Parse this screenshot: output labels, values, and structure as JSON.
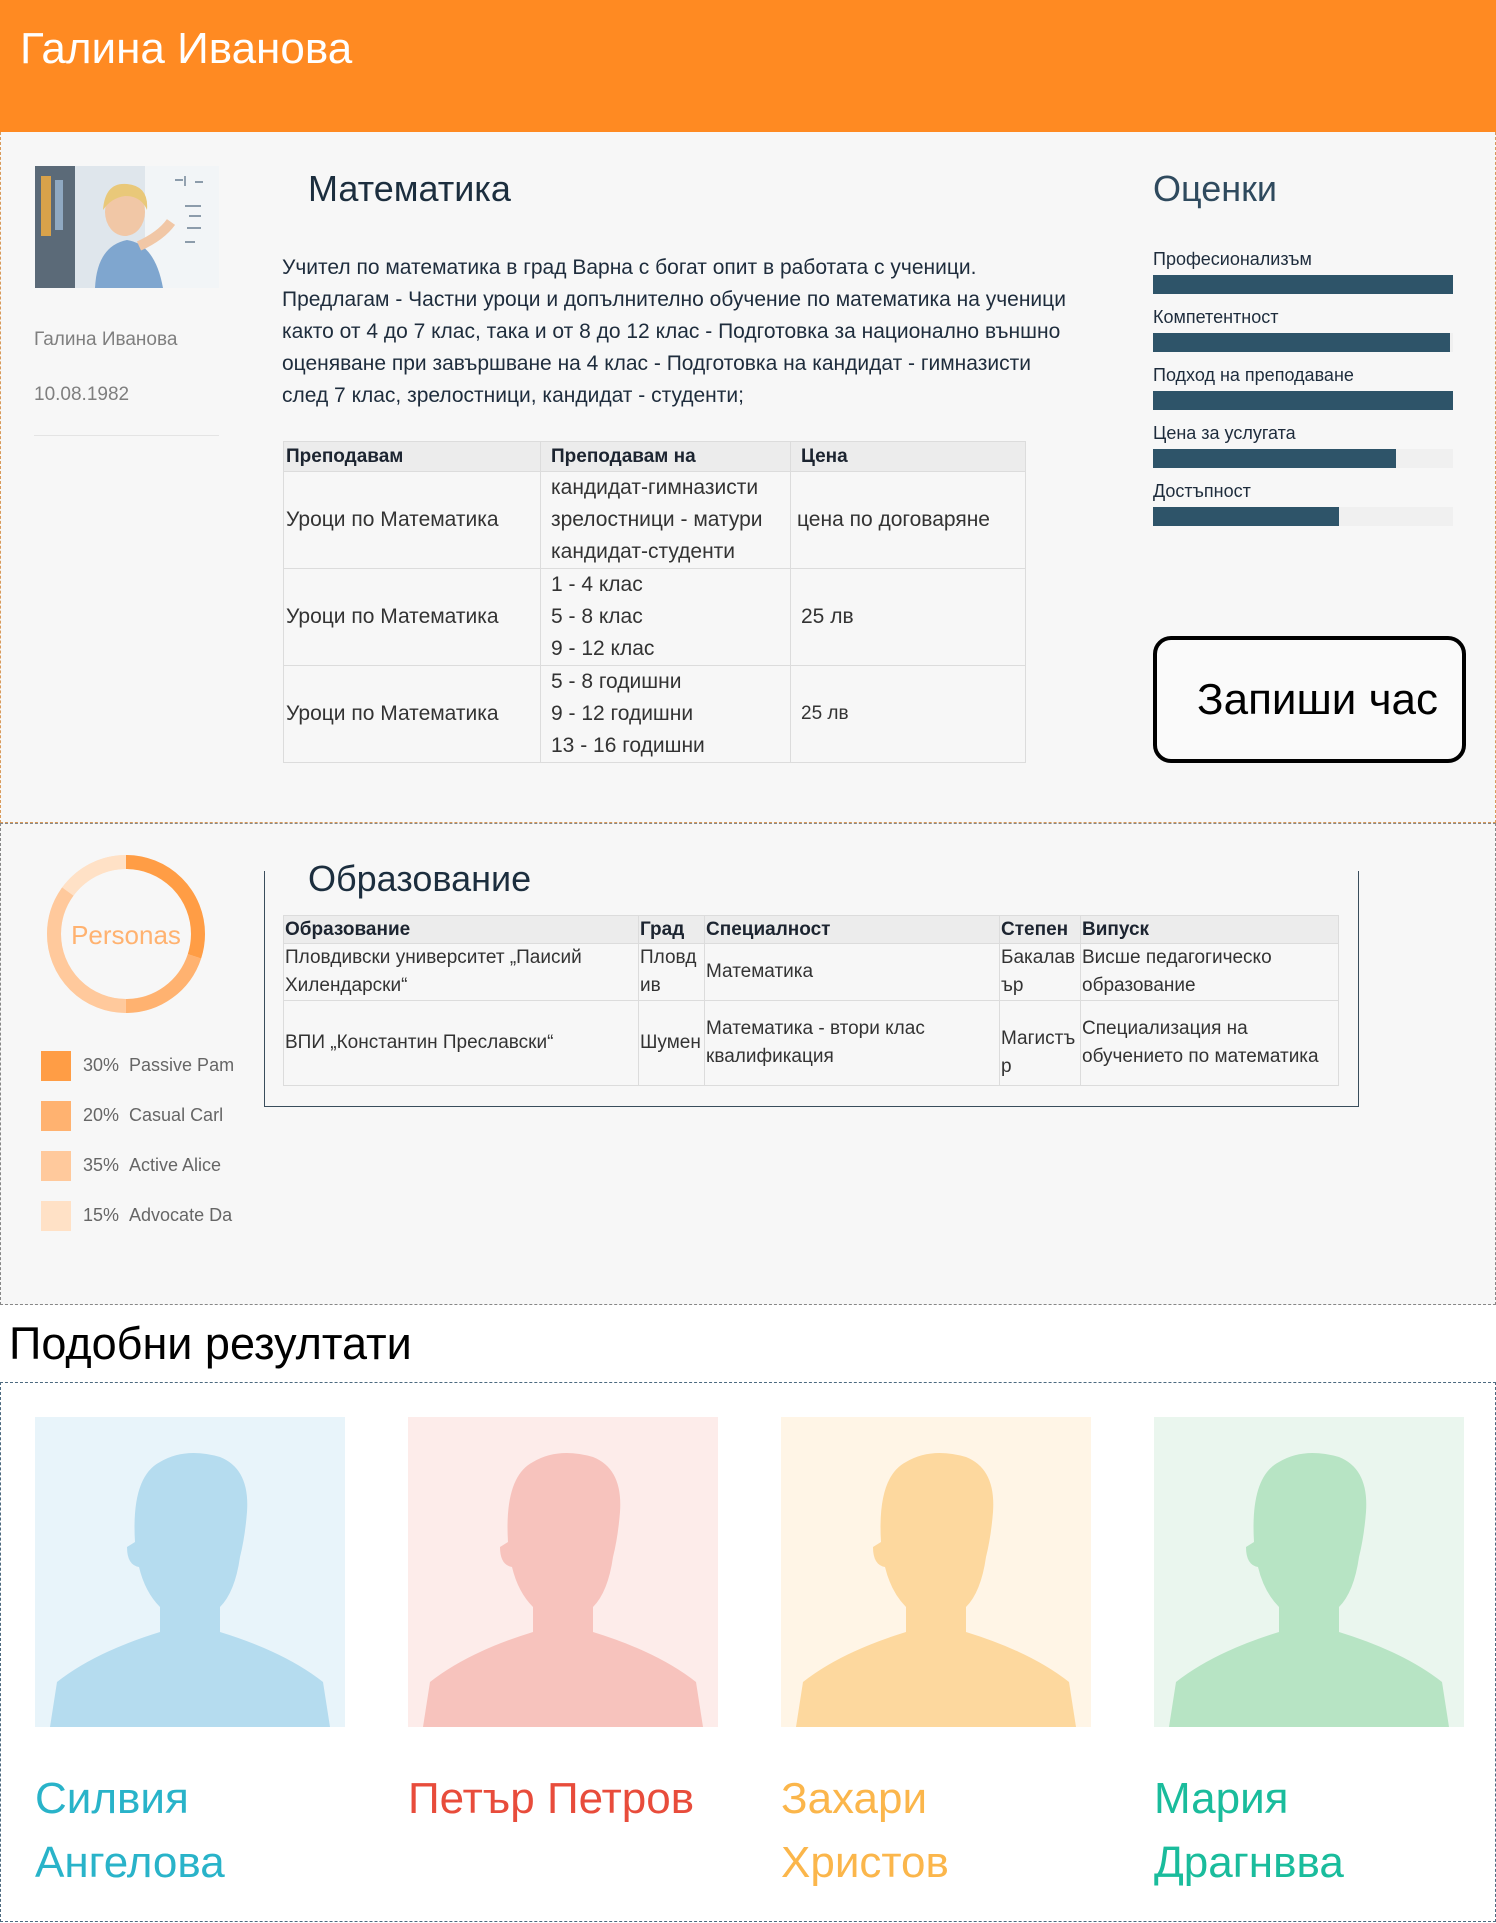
{
  "header": {
    "name": "Галина Иванова"
  },
  "profile": {
    "name": "Галина Иванова",
    "birthdate": "10.08.1982"
  },
  "subject": {
    "title": "Математика",
    "description": "Учител по математика в град Варна с богат опит в работата с ученици. Предлагам - Частни уроци и допълнително обучение по математика на  ученици както от 4 до 7 клас, така и от 8 до 12 клас - Подготовка за национално външно оценяване при завършване на 4 клас - Подготовка на кандидат - гимназисти след 7 клас, зрелостници, кандидат - студенти;"
  },
  "lessons": {
    "headers": [
      "Преподавам",
      "Преподавам на",
      "Цена"
    ],
    "rows": [
      {
        "subject": "Уроци по Математика",
        "audience": [
          "кандидат-гимназисти",
          "зрелостници - матури",
          "кандидат-студенти"
        ],
        "price": "цена по договаряне"
      },
      {
        "subject": "Уроци по Математика",
        "audience": [
          "1 - 4 клас",
          "5 - 8 клас",
          "9 - 12 клас"
        ],
        "price": "25 лв"
      },
      {
        "subject": "Уроци по Математика",
        "audience": [
          "5 - 8 годишни",
          "9 - 12 годишни",
          "13 - 16 годишни"
        ],
        "price": "25 лв"
      }
    ]
  },
  "ratings": {
    "title": "Оценки",
    "items": [
      {
        "label": "Професионализъм",
        "value": 1.0
      },
      {
        "label": "Компетентност",
        "value": 0.99
      },
      {
        "label": "Подход на преподаване",
        "value": 1.0
      },
      {
        "label": "Цена за услугата",
        "value": 0.81
      },
      {
        "label": "Достъпност",
        "value": 0.62
      }
    ],
    "accent_color": "#2e5469"
  },
  "book_button": {
    "label": "Запиши час"
  },
  "personas": {
    "center_label": "Personas",
    "items": [
      {
        "percent": "30%",
        "label": "Passive Pam",
        "color": "#ff9d45"
      },
      {
        "percent": "20%",
        "label": "Casual Carl",
        "color": "#ffb270"
      },
      {
        "percent": "35%",
        "label": "Active Alice",
        "color": "#ffc99c"
      },
      {
        "percent": "15%",
        "label": "Advocate Dan",
        "color": "#ffe1c6"
      }
    ]
  },
  "education": {
    "title": "Образование",
    "headers": [
      "Образование",
      "Град",
      "Специалност",
      "Степен",
      "Випуск"
    ],
    "rows": [
      {
        "school": "Пловдивски университет „Паисий Хилендарски“",
        "city": "Пловдив",
        "specialty": "Математика",
        "degree": "Бакалавър",
        "graduation": "Висше педагогическо образование"
      },
      {
        "school": "ВПИ „Константин Преславски“",
        "city": "Шумен",
        "specialty": "Математика - втори клас квалификация",
        "degree": "Магистър",
        "graduation": "Специализация на обучението по математика"
      }
    ]
  },
  "similar": {
    "title": "Подобни резултати",
    "people": [
      {
        "name": "Силвия Ангелова",
        "color": "#29b3c9",
        "bg": "#e8f4fa",
        "silhouette": "#b5dcef"
      },
      {
        "name": "Петър Петров",
        "color": "#e84c3b",
        "bg": "#fdecea",
        "silhouette": "#f7c3bd"
      },
      {
        "name": "Захари Христов",
        "color": "#fbb64b",
        "bg": "#fff5e6",
        "silhouette": "#fdd89e"
      },
      {
        "name": "Мария Драгнвва",
        "color": "#1abc9c",
        "bg": "#eaf6ee",
        "silhouette": "#b7e4c4"
      }
    ]
  }
}
